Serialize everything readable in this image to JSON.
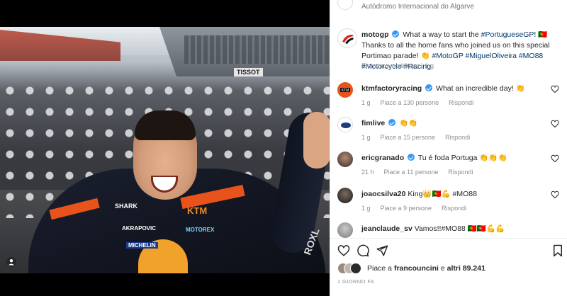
{
  "post": {
    "location": "Autódromo Internacional do Algarve",
    "caption": {
      "username": "motogp",
      "text_1": "What a way to start the",
      "hashtag_portuguese": "#PortugueseGP!",
      "flag_1": "🇵🇹",
      "text_2": "Thanks to all the home fans who joined us on this special Portimao parade!",
      "emoji_1": "👏",
      "hashtags": "#MotoGP #MiguelOliveira #MO88 #Motorcycle #Racing",
      "edited": "Elemento modificato · 1 g"
    },
    "image_text": {
      "sponsor_shark": "SHARK",
      "sponsor_ktm": "KTM",
      "sponsor_akrapovic": "AKRAPOVIC",
      "sponsor_motorex": "MOTOREX",
      "sponsor_michelin": "MICHELIN",
      "banner_tissot": "TISSOT",
      "sponsor_oxley": "ROXL"
    }
  },
  "comments": [
    {
      "username": "ktmfactoryracing",
      "verified": true,
      "text": "What an incredible day! 👏",
      "age": "1 g",
      "likes": "Piace a 130 persone",
      "reply": "Rispondi",
      "avatar_color": "#e8531c"
    },
    {
      "username": "fimlive",
      "verified": true,
      "text": "👏👏",
      "age": "1 g",
      "likes": "Piace a 15 persone",
      "reply": "Rispondi",
      "avatar_color": "#1c3d7a"
    },
    {
      "username": "ericgranado",
      "verified": true,
      "text": "Tu é foda Portuga 👏👏👏",
      "age": "21 h",
      "likes": "Piace a 11 persone",
      "reply": "Rispondi",
      "avatar_color": "#4a3a35"
    },
    {
      "username": "joaocsilva20",
      "verified": false,
      "text": "King👑🇵🇹💪 #MO88",
      "age": "1 g",
      "likes": "Piace a 9 persone",
      "reply": "Rispondi",
      "avatar_color": "#2b2b2b"
    },
    {
      "username": "jeanclaude_sv",
      "verified": false,
      "text": "Vamos!!#MO88 🇵🇹🇵🇹💪💪",
      "age": "",
      "likes": "",
      "reply": "",
      "avatar_color": "#9a9a9a"
    }
  ],
  "likes_bar": {
    "prefix": "Piace a",
    "first_user": "francouncini",
    "suffix": "e",
    "others": "altri 89.241"
  },
  "date": "1 GIORNO FA",
  "colors": {
    "link": "#00376b",
    "verified": "#3897f0",
    "meta": "#8e8e8e"
  },
  "icons": [
    "heart-icon",
    "comment-icon",
    "share-icon",
    "bookmark-icon",
    "user-tag-icon"
  ]
}
